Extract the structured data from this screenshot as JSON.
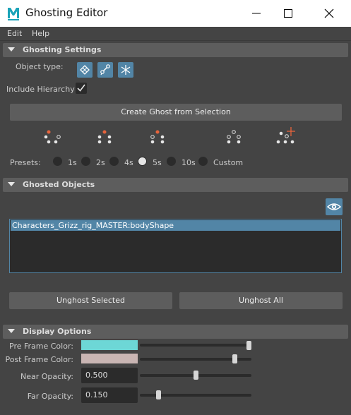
{
  "window": {
    "title": "Ghosting Editor"
  },
  "menubar": {
    "items": [
      "Edit",
      "Help"
    ]
  },
  "ghosting_settings": {
    "header": "Ghosting Settings",
    "object_type_label": "Object type:",
    "object_type_icons": [
      "mesh-object-icon",
      "joint-object-icon",
      "locator-object-icon"
    ],
    "include_hierarchy_label": "Include Hierarchy",
    "include_hierarchy_checked": true,
    "create_button": "Create Ghost from Selection",
    "ghost_type_icons": [
      "ghost-pre-frames-icon",
      "ghost-mid-frames-icon",
      "ghost-post-frames-icon",
      "ghost-keys-icon",
      "ghost-custom-frames-icon"
    ],
    "presets_label": "Presets:",
    "presets": [
      {
        "label": "1s",
        "checked": false
      },
      {
        "label": "2s",
        "checked": false
      },
      {
        "label": "4s",
        "checked": false
      },
      {
        "label": "5s",
        "checked": true
      },
      {
        "label": "10s",
        "checked": false
      },
      {
        "label": "Custom",
        "checked": false
      }
    ]
  },
  "ghosted_objects": {
    "header": "Ghosted Objects",
    "items": [
      "Characters_Grizz_rig_MASTER:bodyShape"
    ],
    "unghost_selected": "Unghost Selected",
    "unghost_all": "Unghost All"
  },
  "display_options": {
    "header": "Display Options",
    "pre_frame_color_label": "Pre Frame Color:",
    "pre_frame_color": "#6dd7d6",
    "pre_frame_color_slider": 1.0,
    "post_frame_color_label": "Post Frame Color:",
    "post_frame_color": "#c9b5b3",
    "post_frame_color_slider": 0.87,
    "near_opacity_label": "Near Opacity:",
    "near_opacity": "0.500",
    "far_opacity_label": "Far Opacity:",
    "far_opacity": "0.150"
  },
  "colors": {
    "accent": "#5285a6",
    "panel": "#444444",
    "section_header": "#5d5d5d",
    "field": "#2b2b2b",
    "ghost_orange": "#e8643c"
  }
}
